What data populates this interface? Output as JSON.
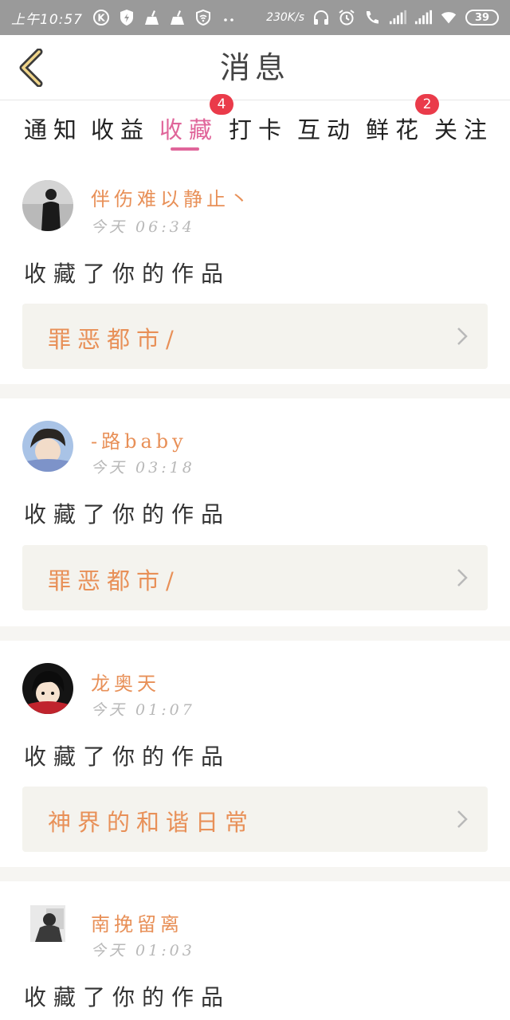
{
  "status_bar": {
    "time": "上午10:57",
    "net_speed": "230K/s",
    "battery": "39",
    "icons": [
      "k-icon",
      "shield-icon",
      "broom-icon",
      "broom-icon",
      "vpn-shield-icon",
      "more-dots-icon",
      "headphones-icon",
      "alarm-icon",
      "call-icon",
      "signal-icon",
      "signal-icon",
      "wifi-icon",
      "battery-icon"
    ]
  },
  "header": {
    "title": "消息",
    "back_icon": "chevron-left-icon"
  },
  "tabs": [
    {
      "label": "通知"
    },
    {
      "label": "收益"
    },
    {
      "label": "收藏",
      "active": true,
      "badge": "4"
    },
    {
      "label": "打卡"
    },
    {
      "label": "互动"
    },
    {
      "label": "鲜花",
      "badge": "2"
    },
    {
      "label": "关注"
    }
  ],
  "colors": {
    "accent": "#e0659a",
    "name": "#e89058",
    "badge": "#ea3b4a",
    "card_bg": "#f4f3ee"
  },
  "feed": [
    {
      "user": "伴伤难以静止丶",
      "time": "今天 06:34",
      "action": "收藏了你的作品",
      "work": "罪恶都市/"
    },
    {
      "user": "-路baby",
      "time": "今天 03:18",
      "action": "收藏了你的作品",
      "work": "罪恶都市/"
    },
    {
      "user": "龙奥天",
      "time": "今天 01:07",
      "action": "收藏了你的作品",
      "work": "神界的和谐日常"
    },
    {
      "user": "南挽留离",
      "time": "今天 01:03",
      "action": "收藏了你的作品"
    }
  ]
}
